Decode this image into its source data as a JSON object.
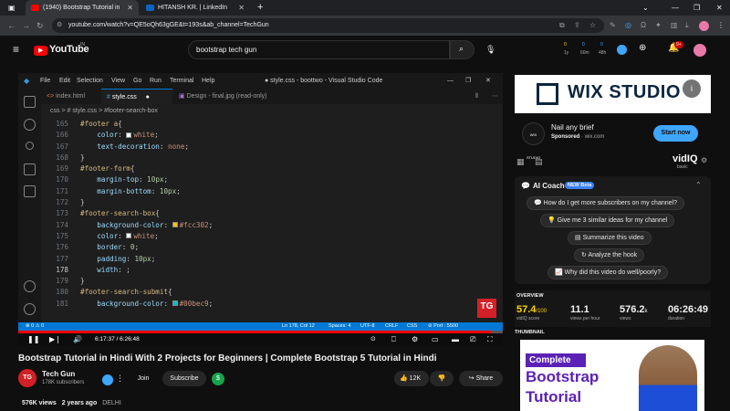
{
  "browser": {
    "tabs": [
      {
        "title": "(1940) Bootstrap Tutorial in",
        "active": true
      },
      {
        "title": "HITANSH KR. | LinkedIn",
        "active": false
      }
    ],
    "new_tab": "+",
    "url": "youtube.com/watch?v=QE5oQh63gGE&t=193s&ab_channel=TechGun",
    "vidiq_counters": [
      "0",
      "0",
      "0",
      "1y",
      "60m",
      "48h"
    ]
  },
  "youtube": {
    "logo": "YouTube",
    "country": "IN",
    "search_query": "bootstrap tech gun",
    "notification_count": "9+"
  },
  "vscode": {
    "window_title": "● style.css - boottwo - Visual Studio Code",
    "menu": [
      "File",
      "Edit",
      "Selection",
      "View",
      "Go",
      "Run",
      "Terminal",
      "Help"
    ],
    "tabs": [
      "index.html",
      "style.css",
      "Design - final.jpg (read-only)"
    ],
    "breadcrumb": "css > # style.css > #footer-search-box",
    "lines": [
      {
        "n": "165",
        "parts": [
          [
            "sel",
            "#footer a"
          ],
          [
            "pun",
            "{"
          ]
        ]
      },
      {
        "n": "166",
        "parts": [
          [
            "pun",
            "    "
          ],
          [
            "prop",
            "color"
          ],
          [
            "pun",
            ": "
          ],
          [
            "swatch",
            "#ffffff"
          ],
          [
            "val",
            "white"
          ],
          [
            "pun",
            ";"
          ]
        ]
      },
      {
        "n": "167",
        "parts": [
          [
            "pun",
            "    "
          ],
          [
            "prop",
            "text-decoration"
          ],
          [
            "pun",
            ": "
          ],
          [
            "val",
            "none"
          ],
          [
            "pun",
            ";"
          ]
        ]
      },
      {
        "n": "168",
        "parts": [
          [
            "pun",
            "}"
          ]
        ]
      },
      {
        "n": "169",
        "parts": [
          [
            "sel",
            "#footer-form"
          ],
          [
            "pun",
            "{"
          ]
        ]
      },
      {
        "n": "170",
        "parts": [
          [
            "pun",
            "    "
          ],
          [
            "prop",
            "margin-top"
          ],
          [
            "pun",
            ": "
          ],
          [
            "num",
            "10px"
          ],
          [
            "pun",
            ";"
          ]
        ]
      },
      {
        "n": "171",
        "parts": [
          [
            "pun",
            "    "
          ],
          [
            "prop",
            "margin-bottom"
          ],
          [
            "pun",
            ": "
          ],
          [
            "num",
            "10px"
          ],
          [
            "pun",
            ";"
          ]
        ]
      },
      {
        "n": "172",
        "parts": [
          [
            "pun",
            "}"
          ]
        ]
      },
      {
        "n": "173",
        "parts": [
          [
            "sel",
            "#footer-search-box"
          ],
          [
            "pun",
            "{"
          ]
        ]
      },
      {
        "n": "174",
        "parts": [
          [
            "pun",
            "    "
          ],
          [
            "prop",
            "background-color"
          ],
          [
            "pun",
            ": "
          ],
          [
            "swatch",
            "#fcc302"
          ],
          [
            "val",
            "#fcc302"
          ],
          [
            "pun",
            ";"
          ]
        ]
      },
      {
        "n": "175",
        "parts": [
          [
            "pun",
            "    "
          ],
          [
            "prop",
            "color"
          ],
          [
            "pun",
            ": "
          ],
          [
            "swatch",
            "#ffffff"
          ],
          [
            "val",
            "white"
          ],
          [
            "pun",
            ";"
          ]
        ]
      },
      {
        "n": "176",
        "parts": [
          [
            "pun",
            "    "
          ],
          [
            "prop",
            "border"
          ],
          [
            "pun",
            ": "
          ],
          [
            "num",
            "0"
          ],
          [
            "pun",
            ";"
          ]
        ]
      },
      {
        "n": "177",
        "parts": [
          [
            "pun",
            "    "
          ],
          [
            "prop",
            "padding"
          ],
          [
            "pun",
            ": "
          ],
          [
            "num",
            "10px"
          ],
          [
            "pun",
            ";"
          ]
        ]
      },
      {
        "n": "178",
        "parts": [
          [
            "pun",
            "    "
          ],
          [
            "prop",
            "width"
          ],
          [
            "pun",
            ": ;"
          ]
        ],
        "current": true
      },
      {
        "n": "179",
        "parts": [
          [
            "pun",
            "}"
          ]
        ]
      },
      {
        "n": "180",
        "parts": [
          [
            "sel",
            "#footer-search-submit"
          ],
          [
            "pun",
            "{"
          ]
        ]
      },
      {
        "n": "181",
        "parts": [
          [
            "pun",
            "    "
          ],
          [
            "prop",
            "background-color"
          ],
          [
            "pun",
            ": "
          ],
          [
            "swatch",
            "#00bec9"
          ],
          [
            "val",
            "#00bec9"
          ],
          [
            "pun",
            ";"
          ]
        ]
      }
    ],
    "status_left": "⊗ 0 ⚠ 0",
    "status_right": [
      "Ln 178, Col 12",
      "Spaces: 4",
      "UTF-8",
      "CRLF",
      "CSS",
      "⊘ Port : 5500"
    ],
    "channel_watermark": "TG"
  },
  "player": {
    "time": "6:17:37 / 6:26:48",
    "progress": 0.976
  },
  "video": {
    "title": "Bootstrap Tutorial in Hindi With 2 Projects for Beginners | Complete Bootstrap 5 Tutorial in Hindi",
    "channel": "Tech Gun",
    "channel_avatar": "TG",
    "subscribers": "178K subscribers",
    "join": "Join",
    "subscribe": "Subscribe",
    "likes": "12K",
    "share": "Share",
    "meta": {
      "views": "576K views",
      "age": "2 years ago",
      "location": "DELHI"
    }
  },
  "ad": {
    "brand": "WIX STUDIO",
    "info": "i",
    "logo_text": "WIX STUDIO",
    "title": "Nail any brief",
    "sponsored": "Sponsored",
    "domain": "wix.com",
    "cta": "Start now"
  },
  "vidiq": {
    "brand": "vidIQ",
    "plan": "basic",
    "ai_coach": "AI Coach",
    "badge": "NEW Beta",
    "prompts": [
      "How do I get more subscribers on my channel?",
      "Give me 3 similar ideas for my channel",
      "Summarize this video",
      "Analyze the hook",
      "Why did this video do well/poorly?"
    ],
    "overview_label": "OVERVIEW",
    "stats": [
      {
        "value": "57.4",
        "suffix": "/100",
        "label": "vidIQ score"
      },
      {
        "value": "11.1",
        "suffix": "",
        "label": "views per hour"
      },
      {
        "value": "576.2",
        "suffix": "k",
        "label": "views"
      },
      {
        "value": "06:26:49",
        "suffix": "",
        "label": "duration"
      }
    ],
    "thumbnail_label": "THUMBNAIL",
    "thumbnail_text": [
      "Complete",
      "Bootstrap",
      "Tutorial"
    ]
  }
}
